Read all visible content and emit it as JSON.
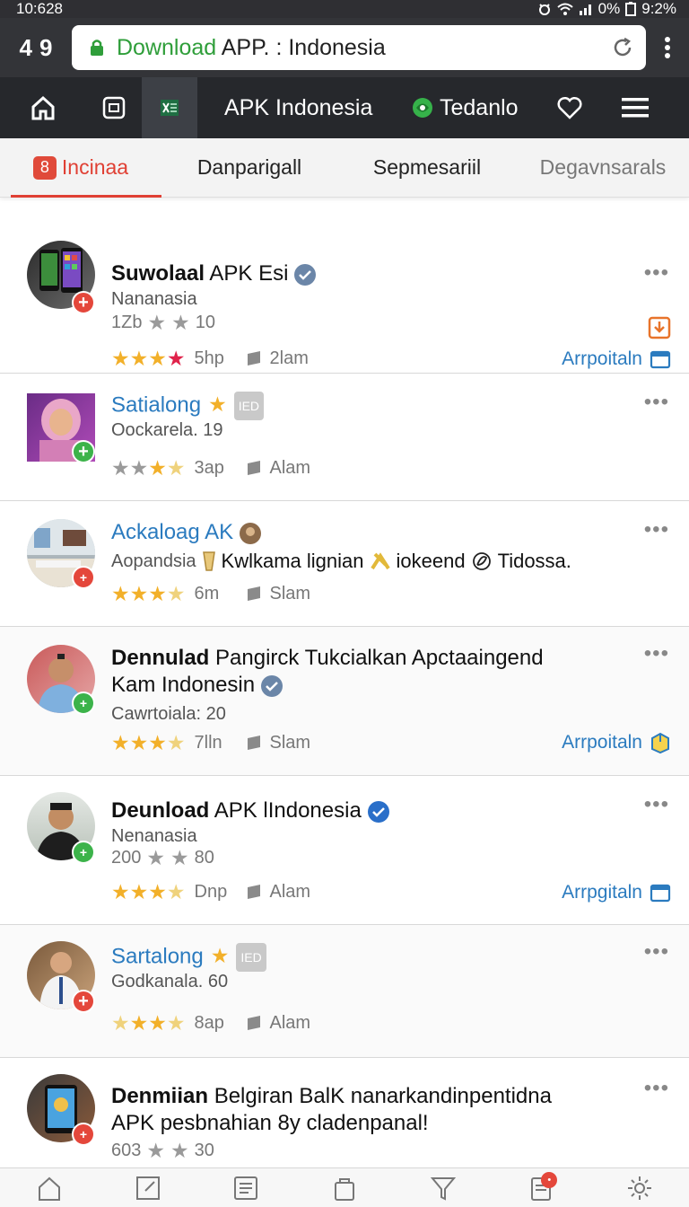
{
  "status_bar": {
    "time": "10:628",
    "battery": "0%",
    "extra": "9:2%"
  },
  "browser": {
    "tab_label": "4",
    "tab_count": "9",
    "url_host": "Download",
    "url_rest": " APP. : Indonesia"
  },
  "site_nav": {
    "title": "APK Indonesia",
    "brand": "Tedanlo"
  },
  "category_tabs": [
    {
      "label": "Incinaa",
      "badge": "8"
    },
    {
      "label": "Danparigall"
    },
    {
      "label": "Sepmesariil"
    },
    {
      "label": "Degavnsarals"
    }
  ],
  "items": [
    {
      "title_bold": "Suwolaal",
      "title_rest": " APK Esi",
      "sub": "Nananasia",
      "meta_a": "1Zb",
      "meta_b": "10",
      "length": "5hp",
      "tag": "2lam",
      "action": "Arrpoitaln",
      "more": "•••"
    },
    {
      "title_bold": "",
      "title_rest": "Satialong",
      "chip": "IED",
      "sub": "Oockarela. 19",
      "length": "3ap",
      "tag": "Alam",
      "more": "•••"
    },
    {
      "title_bold": "",
      "title_rest": "Ackaloag AK",
      "sub": "Aopandsia",
      "sub_extra": [
        "Kwlkama lignian",
        "iokeend",
        "Tidossa."
      ],
      "length": "6m",
      "tag": "Slam",
      "more": "•••"
    },
    {
      "title_bold": "Dennulad",
      "title_rest": " Pangirck Tukcialkan Apctaaingend Kam Indonesin",
      "sub": "Cawrtoiala: 20",
      "length": "7lln",
      "tag": "Slam",
      "action": "Arrpoitaln",
      "more": "•••"
    },
    {
      "title_bold": "Deunload",
      "title_rest": " APK lIndonesia",
      "sub": "Nenanasia",
      "meta_a": "200",
      "meta_b": "80",
      "length": "Dnp",
      "tag": "Alam",
      "action": "Arrpgitaln",
      "more": "•••"
    },
    {
      "title_bold": "",
      "title_rest": "Sartalong",
      "chip": "IED",
      "sub": "Godkanala. 60",
      "length": "8ap",
      "tag": "Alam",
      "more": "•••"
    },
    {
      "title_bold": "Denmiian",
      "title_rest": " Belgiran BalK nanarkandinpentidna APK pesbnahian 8y cladenpanal!",
      "meta_a": "603",
      "meta_b": "30",
      "more": "•••"
    }
  ],
  "colors": {
    "accent": "#e04034",
    "link": "#2b7bbf",
    "nav_bg": "#26282c",
    "star": "#f2b02a"
  }
}
